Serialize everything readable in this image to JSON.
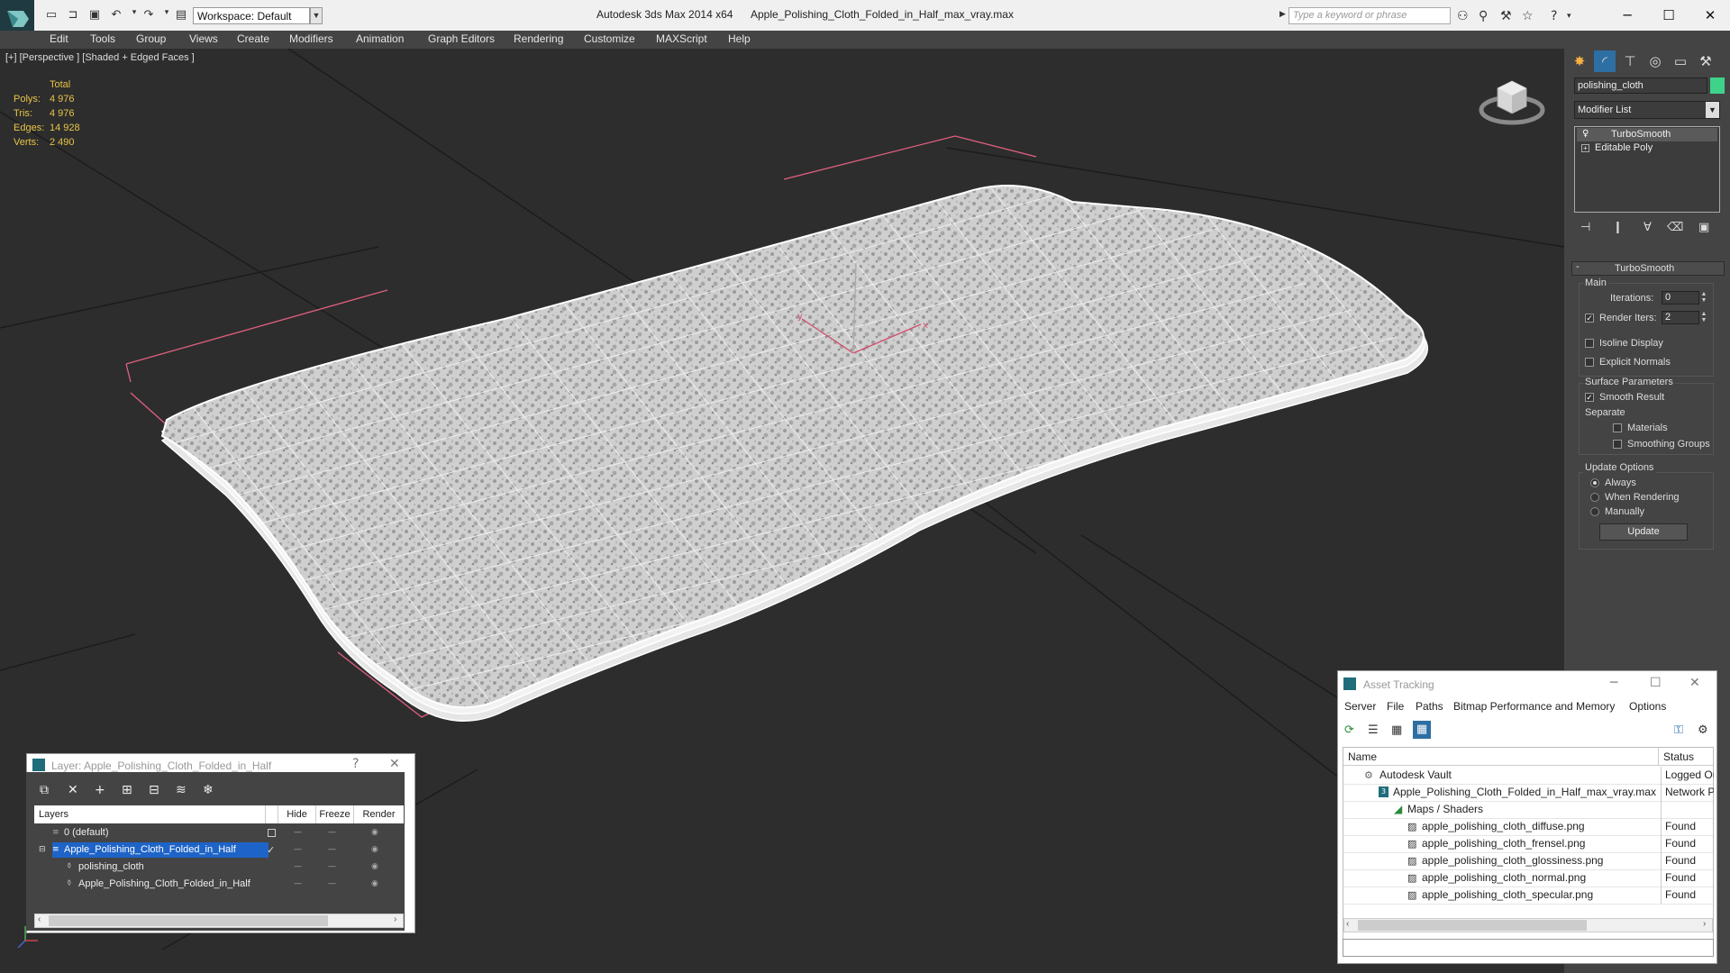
{
  "window": {
    "app_title": "Autodesk 3ds Max  2014 x64",
    "file_title": "Apple_Polishing_Cloth_Folded_in_Half_max_vray.max",
    "workspace": "Workspace: Default",
    "search_placeholder": "Type a keyword or phrase"
  },
  "menu": [
    "Edit",
    "Tools",
    "Group",
    "Views",
    "Create",
    "Modifiers",
    "Animation",
    "Graph Editors",
    "Rendering",
    "Customize",
    "MAXScript",
    "Help"
  ],
  "viewport": {
    "label": "[+] [Perspective ] [Shaded + Edged Faces ]",
    "stats_header": "Total",
    "stats": [
      {
        "label": "Polys:",
        "value": "4 976"
      },
      {
        "label": "Tris:",
        "value": "4 976"
      },
      {
        "label": "Edges:",
        "value": "14 928"
      },
      {
        "label": "Verts:",
        "value": "2 490"
      }
    ],
    "axis": {
      "x": "x",
      "y": "y",
      "z": "z"
    }
  },
  "command_panel": {
    "object_name": "polishing_cloth",
    "object_color": "#3fd28a",
    "modifier_list": "Modifier List",
    "stack": [
      "TurboSmooth",
      "Editable Poly"
    ],
    "rollout_title": "TurboSmooth",
    "main_group": "Main",
    "iterations_label": "Iterations:",
    "iterations_value": "0",
    "render_iters_label": "Render Iters:",
    "render_iters_value": "2",
    "render_iters_checked": true,
    "isoline_display": "Isoline Display",
    "explicit_normals": "Explicit Normals",
    "surface_params": "Surface Parameters",
    "smooth_result": "Smooth Result",
    "smooth_result_checked": true,
    "separate": "Separate",
    "materials": "Materials",
    "smoothing_groups": "Smoothing Groups",
    "update_options": "Update Options",
    "update_always": "Always",
    "update_when_rendering": "When Rendering",
    "update_manually": "Manually",
    "selected_update_option": "Always",
    "update_button": "Update"
  },
  "layer_dialog": {
    "title": "Layer: Apple_Polishing_Cloth_Folded_in_Half",
    "help": "?",
    "columns": [
      "Layers",
      "Hide",
      "Freeze",
      "Render"
    ],
    "rows": [
      {
        "name": "0 (default)",
        "level": 0,
        "selected": false
      },
      {
        "name": "Apple_Polishing_Cloth_Folded_in_Half",
        "level": 0,
        "selected": true
      },
      {
        "name": "polishing_cloth",
        "level": 1,
        "selected": false
      },
      {
        "name": "Apple_Polishing_Cloth_Folded_in_Half",
        "level": 1,
        "selected": false
      }
    ]
  },
  "asset_tracking": {
    "title": "Asset Tracking",
    "menu": [
      "Server",
      "File",
      "Paths",
      "Bitmap Performance and Memory",
      "Options"
    ],
    "columns": [
      "Name",
      "Status"
    ],
    "rows": [
      {
        "name": "Autodesk Vault",
        "status": "Logged Ou",
        "level": 0
      },
      {
        "name": "Apple_Polishing_Cloth_Folded_in_Half_max_vray.max",
        "status": "Network P",
        "level": 1
      },
      {
        "name": "Maps / Shaders",
        "status": "",
        "level": 2
      },
      {
        "name": "apple_polishing_cloth_diffuse.png",
        "status": "Found",
        "level": 3
      },
      {
        "name": "apple_polishing_cloth_frensel.png",
        "status": "Found",
        "level": 3
      },
      {
        "name": "apple_polishing_cloth_glossiness.png",
        "status": "Found",
        "level": 3
      },
      {
        "name": "apple_polishing_cloth_normal.png",
        "status": "Found",
        "level": 3
      },
      {
        "name": "apple_polishing_cloth_specular.png",
        "status": "Found",
        "level": 3
      }
    ]
  }
}
